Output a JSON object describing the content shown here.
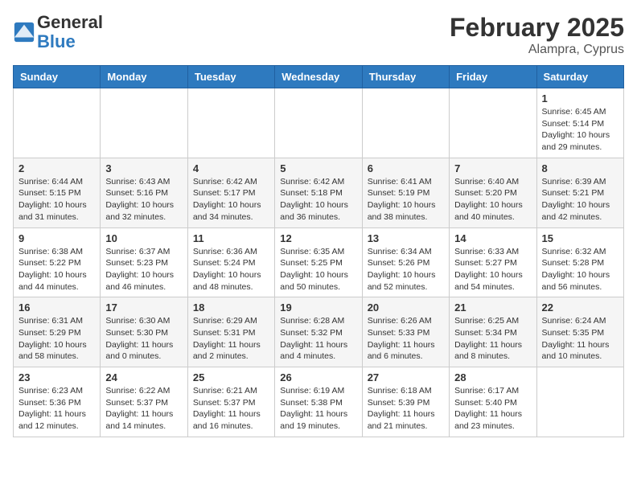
{
  "header": {
    "logo_text_general": "General",
    "logo_text_blue": "Blue",
    "month_year": "February 2025",
    "location": "Alampra, Cyprus"
  },
  "weekdays": [
    "Sunday",
    "Monday",
    "Tuesday",
    "Wednesday",
    "Thursday",
    "Friday",
    "Saturday"
  ],
  "weeks": [
    [
      {
        "day": "",
        "sunrise": "",
        "sunset": "",
        "daylight": ""
      },
      {
        "day": "",
        "sunrise": "",
        "sunset": "",
        "daylight": ""
      },
      {
        "day": "",
        "sunrise": "",
        "sunset": "",
        "daylight": ""
      },
      {
        "day": "",
        "sunrise": "",
        "sunset": "",
        "daylight": ""
      },
      {
        "day": "",
        "sunrise": "",
        "sunset": "",
        "daylight": ""
      },
      {
        "day": "",
        "sunrise": "",
        "sunset": "",
        "daylight": ""
      },
      {
        "day": "1",
        "sunrise": "Sunrise: 6:45 AM",
        "sunset": "Sunset: 5:14 PM",
        "daylight": "Daylight: 10 hours and 29 minutes."
      }
    ],
    [
      {
        "day": "2",
        "sunrise": "Sunrise: 6:44 AM",
        "sunset": "Sunset: 5:15 PM",
        "daylight": "Daylight: 10 hours and 31 minutes."
      },
      {
        "day": "3",
        "sunrise": "Sunrise: 6:43 AM",
        "sunset": "Sunset: 5:16 PM",
        "daylight": "Daylight: 10 hours and 32 minutes."
      },
      {
        "day": "4",
        "sunrise": "Sunrise: 6:42 AM",
        "sunset": "Sunset: 5:17 PM",
        "daylight": "Daylight: 10 hours and 34 minutes."
      },
      {
        "day": "5",
        "sunrise": "Sunrise: 6:42 AM",
        "sunset": "Sunset: 5:18 PM",
        "daylight": "Daylight: 10 hours and 36 minutes."
      },
      {
        "day": "6",
        "sunrise": "Sunrise: 6:41 AM",
        "sunset": "Sunset: 5:19 PM",
        "daylight": "Daylight: 10 hours and 38 minutes."
      },
      {
        "day": "7",
        "sunrise": "Sunrise: 6:40 AM",
        "sunset": "Sunset: 5:20 PM",
        "daylight": "Daylight: 10 hours and 40 minutes."
      },
      {
        "day": "8",
        "sunrise": "Sunrise: 6:39 AM",
        "sunset": "Sunset: 5:21 PM",
        "daylight": "Daylight: 10 hours and 42 minutes."
      }
    ],
    [
      {
        "day": "9",
        "sunrise": "Sunrise: 6:38 AM",
        "sunset": "Sunset: 5:22 PM",
        "daylight": "Daylight: 10 hours and 44 minutes."
      },
      {
        "day": "10",
        "sunrise": "Sunrise: 6:37 AM",
        "sunset": "Sunset: 5:23 PM",
        "daylight": "Daylight: 10 hours and 46 minutes."
      },
      {
        "day": "11",
        "sunrise": "Sunrise: 6:36 AM",
        "sunset": "Sunset: 5:24 PM",
        "daylight": "Daylight: 10 hours and 48 minutes."
      },
      {
        "day": "12",
        "sunrise": "Sunrise: 6:35 AM",
        "sunset": "Sunset: 5:25 PM",
        "daylight": "Daylight: 10 hours and 50 minutes."
      },
      {
        "day": "13",
        "sunrise": "Sunrise: 6:34 AM",
        "sunset": "Sunset: 5:26 PM",
        "daylight": "Daylight: 10 hours and 52 minutes."
      },
      {
        "day": "14",
        "sunrise": "Sunrise: 6:33 AM",
        "sunset": "Sunset: 5:27 PM",
        "daylight": "Daylight: 10 hours and 54 minutes."
      },
      {
        "day": "15",
        "sunrise": "Sunrise: 6:32 AM",
        "sunset": "Sunset: 5:28 PM",
        "daylight": "Daylight: 10 hours and 56 minutes."
      }
    ],
    [
      {
        "day": "16",
        "sunrise": "Sunrise: 6:31 AM",
        "sunset": "Sunset: 5:29 PM",
        "daylight": "Daylight: 10 hours and 58 minutes."
      },
      {
        "day": "17",
        "sunrise": "Sunrise: 6:30 AM",
        "sunset": "Sunset: 5:30 PM",
        "daylight": "Daylight: 11 hours and 0 minutes."
      },
      {
        "day": "18",
        "sunrise": "Sunrise: 6:29 AM",
        "sunset": "Sunset: 5:31 PM",
        "daylight": "Daylight: 11 hours and 2 minutes."
      },
      {
        "day": "19",
        "sunrise": "Sunrise: 6:28 AM",
        "sunset": "Sunset: 5:32 PM",
        "daylight": "Daylight: 11 hours and 4 minutes."
      },
      {
        "day": "20",
        "sunrise": "Sunrise: 6:26 AM",
        "sunset": "Sunset: 5:33 PM",
        "daylight": "Daylight: 11 hours and 6 minutes."
      },
      {
        "day": "21",
        "sunrise": "Sunrise: 6:25 AM",
        "sunset": "Sunset: 5:34 PM",
        "daylight": "Daylight: 11 hours and 8 minutes."
      },
      {
        "day": "22",
        "sunrise": "Sunrise: 6:24 AM",
        "sunset": "Sunset: 5:35 PM",
        "daylight": "Daylight: 11 hours and 10 minutes."
      }
    ],
    [
      {
        "day": "23",
        "sunrise": "Sunrise: 6:23 AM",
        "sunset": "Sunset: 5:36 PM",
        "daylight": "Daylight: 11 hours and 12 minutes."
      },
      {
        "day": "24",
        "sunrise": "Sunrise: 6:22 AM",
        "sunset": "Sunset: 5:37 PM",
        "daylight": "Daylight: 11 hours and 14 minutes."
      },
      {
        "day": "25",
        "sunrise": "Sunrise: 6:21 AM",
        "sunset": "Sunset: 5:37 PM",
        "daylight": "Daylight: 11 hours and 16 minutes."
      },
      {
        "day": "26",
        "sunrise": "Sunrise: 6:19 AM",
        "sunset": "Sunset: 5:38 PM",
        "daylight": "Daylight: 11 hours and 19 minutes."
      },
      {
        "day": "27",
        "sunrise": "Sunrise: 6:18 AM",
        "sunset": "Sunset: 5:39 PM",
        "daylight": "Daylight: 11 hours and 21 minutes."
      },
      {
        "day": "28",
        "sunrise": "Sunrise: 6:17 AM",
        "sunset": "Sunset: 5:40 PM",
        "daylight": "Daylight: 11 hours and 23 minutes."
      },
      {
        "day": "",
        "sunrise": "",
        "sunset": "",
        "daylight": ""
      }
    ]
  ]
}
